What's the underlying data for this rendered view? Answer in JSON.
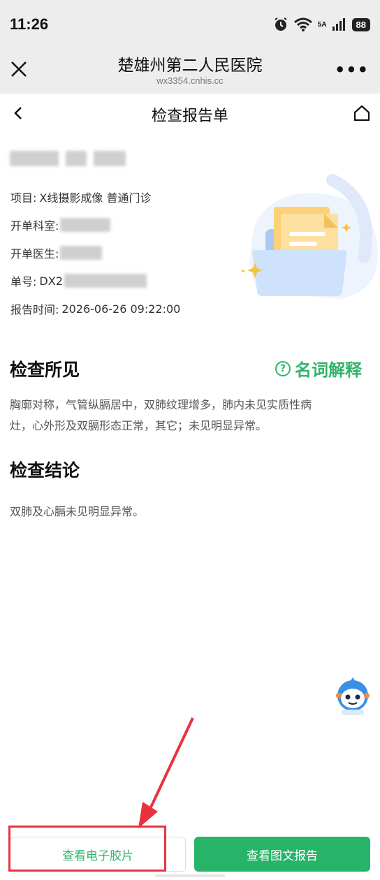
{
  "status_bar": {
    "time": "11:26",
    "network": "5A",
    "battery": "88"
  },
  "wechat_bar": {
    "title": "楚雄州第二人民医院",
    "url": "wx3354.cnhis.cc"
  },
  "nav": {
    "title": "检查报告单"
  },
  "report_info": {
    "project_label": "项目:",
    "project_value": "X线摄影成像 普通门诊",
    "dept_label": "开单科室:",
    "doctor_label": "开单医生:",
    "number_label": "单号:",
    "number_prefix": "DX2",
    "time_label": "报告时间:",
    "time_value": "2026-06-26 09:22:00"
  },
  "findings": {
    "title": "检查所见",
    "explain_label": "名词解释",
    "text_line1": "胸廓对称，气管纵膈居中，双肺纹理增多，肺内未见实质性病",
    "text_line2": "灶，心外形及双膈形态正常，其它；未见明显异常。"
  },
  "conclusion": {
    "title": "检查结论",
    "text": "双肺及心膈未见明显异常。"
  },
  "buttons": {
    "film_label": "查看电子胶片",
    "report_label": "查看图文报告"
  },
  "colors": {
    "accent_green": "#2fb56a",
    "button_green": "#28b468",
    "annotation_red": "#e8333f"
  }
}
